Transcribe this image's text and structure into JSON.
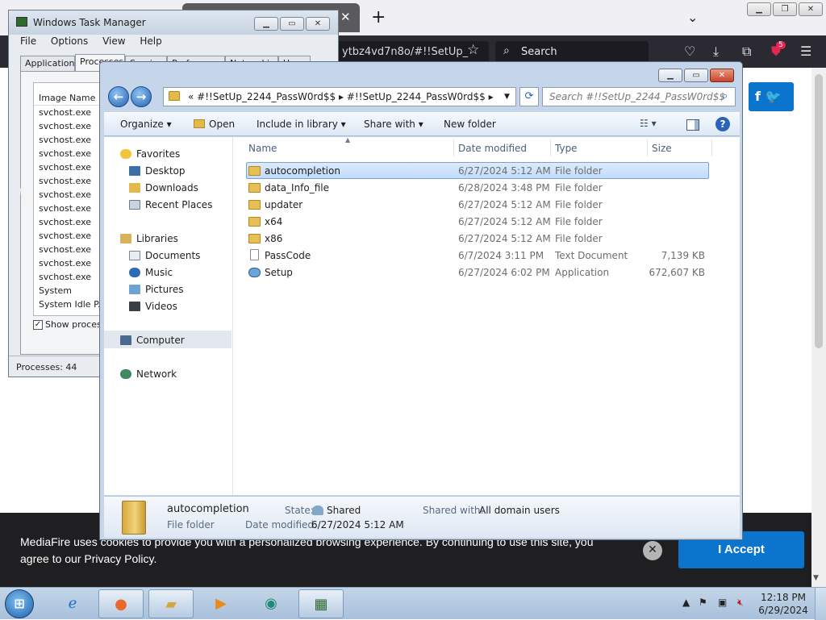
{
  "browser": {
    "url": "ytbz4vd7n8o/#!!SetUp_",
    "search_label": "Search",
    "new_tab": "+",
    "extension_badge": "5",
    "social": "f  🐦"
  },
  "cookie": {
    "text": "MediaFire uses cookies to provide you with a personalized browsing experience. By continuing to use this site, you agree to our Privacy Policy.",
    "accept_label": "I Accept",
    "close_label": "✕"
  },
  "taskmgr": {
    "title": "Windows Task Manager",
    "menu": [
      "File",
      "Options",
      "View",
      "Help"
    ],
    "tabs": [
      "Applications",
      "Processes",
      "Services",
      "Performance",
      "Networking",
      "Users"
    ],
    "column_header": "Image Name",
    "processes": [
      "svchost.exe",
      "svchost.exe",
      "svchost.exe",
      "svchost.exe",
      "svchost.exe",
      "svchost.exe",
      "svchost.exe",
      "svchost.exe",
      "svchost.exe",
      "svchost.exe",
      "svchost.exe",
      "svchost.exe",
      "svchost.exe",
      "System",
      "System Idle P..."
    ],
    "show_all_label": "Show process",
    "status": "Processes: 44"
  },
  "explorer": {
    "breadcrumb": "«  #!!SetUp_2244_PassW0rd$$  ▸  #!!SetUp_2244_PassW0rd$$  ▸",
    "search_placeholder": "Search #!!SetUp_2244_PassW0rd$$",
    "toolbar": {
      "organize": "Organize ▾",
      "open": "Open",
      "include": "Include in library ▾",
      "share": "Share with ▾",
      "new_folder": "New folder",
      "views": "☷ ▾"
    },
    "nav": {
      "favorites": "Favorites",
      "desktop": "Desktop",
      "downloads": "Downloads",
      "recent": "Recent Places",
      "libraries": "Libraries",
      "documents": "Documents",
      "music": "Music",
      "pictures": "Pictures",
      "videos": "Videos",
      "computer": "Computer",
      "network": "Network"
    },
    "columns": {
      "name": "Name",
      "date": "Date modified",
      "type": "Type",
      "size": "Size"
    },
    "files": [
      {
        "name": "autocompletion",
        "date": "6/27/2024 5:12 AM",
        "type": "File folder",
        "size": ""
      },
      {
        "name": "data_Info_file",
        "date": "6/28/2024 3:48 PM",
        "type": "File folder",
        "size": ""
      },
      {
        "name": "updater",
        "date": "6/27/2024 5:12 AM",
        "type": "File folder",
        "size": ""
      },
      {
        "name": "x64",
        "date": "6/27/2024 5:12 AM",
        "type": "File folder",
        "size": ""
      },
      {
        "name": "x86",
        "date": "6/27/2024 5:12 AM",
        "type": "File folder",
        "size": ""
      },
      {
        "name": "PassCode",
        "date": "6/7/2024 3:11 PM",
        "type": "Text Document",
        "size": "7,139 KB"
      },
      {
        "name": "Setup",
        "date": "6/27/2024 6:02 PM",
        "type": "Application",
        "size": "672,607 KB"
      }
    ],
    "details": {
      "name": "autocompletion",
      "kind": "File folder",
      "state_label": "State:",
      "state_value": "Shared",
      "date_label": "Date modified:",
      "date_value": "6/27/2024 5:12 AM",
      "shared_label": "Shared with:",
      "shared_value": "All domain users"
    }
  },
  "taskbar": {
    "time": "12:18 PM",
    "date": "6/29/2024"
  }
}
